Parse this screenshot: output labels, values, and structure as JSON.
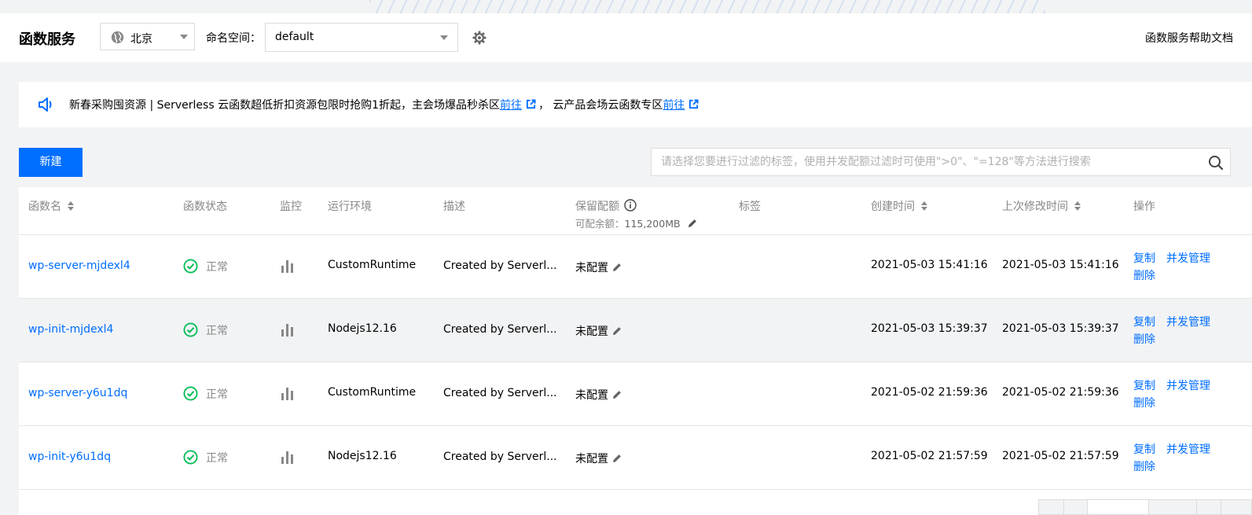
{
  "header": {
    "app_title": "函数服务",
    "region": {
      "label": "北京",
      "icon": "globe-icon"
    },
    "namespace": {
      "label": "命名空间：",
      "value": "default"
    },
    "settings_icon": "gear-icon",
    "help_link": "函数服务帮助文档"
  },
  "notice": {
    "icon": "speaker-icon",
    "text_before": "新春采购囤资源 | Serverless 云函数超低折扣资源包限时抢购1折起，主会场爆品秒杀区",
    "link1": "前往",
    "text_middle": "， 云产品会场云函数专区",
    "link2": "前往"
  },
  "toolbar": {
    "new_button": "新建",
    "search_placeholder": "请选择您要进行过滤的标签，使用并发配额过滤时可使用\">0\"、\"=128\"等方法进行搜索"
  },
  "table": {
    "columns": {
      "name": "函数名",
      "status": "函数状态",
      "monitor": "监控",
      "runtime": "运行环境",
      "description": "描述",
      "quota": "保留配额",
      "quota_sub_label": "可配余额：",
      "quota_sub_value": "115,200MB",
      "tags": "标签",
      "created": "创建时间",
      "modified": "上次修改时间",
      "actions": "操作"
    },
    "rows": [
      {
        "name": "wp-server-mjdexl4",
        "status": "正常",
        "runtime": "CustomRuntime",
        "description": "Created by Serverl...",
        "quota": "未配置",
        "created": "2021-05-03 15:41:16",
        "modified": "2021-05-03 15:41:16"
      },
      {
        "name": "wp-init-mjdexl4",
        "status": "正常",
        "runtime": "Nodejs12.16",
        "description": "Created by Serverl...",
        "quota": "未配置",
        "created": "2021-05-03 15:39:37",
        "modified": "2021-05-03 15:39:37"
      },
      {
        "name": "wp-server-y6u1dq",
        "status": "正常",
        "runtime": "CustomRuntime",
        "description": "Created by Serverl...",
        "quota": "未配置",
        "created": "2021-05-02 21:59:36",
        "modified": "2021-05-02 21:59:36"
      },
      {
        "name": "wp-init-y6u1dq",
        "status": "正常",
        "runtime": "Nodejs12.16",
        "description": "Created by Serverl...",
        "quota": "未配置",
        "created": "2021-05-02 21:57:59",
        "modified": "2021-05-02 21:57:59"
      }
    ],
    "actions": {
      "copy": "复制",
      "concurrency": "并发管理",
      "delete": "删除"
    }
  },
  "colors": {
    "accent": "#006eff",
    "success": "#0abf5b",
    "background": "#f2f3f5"
  }
}
